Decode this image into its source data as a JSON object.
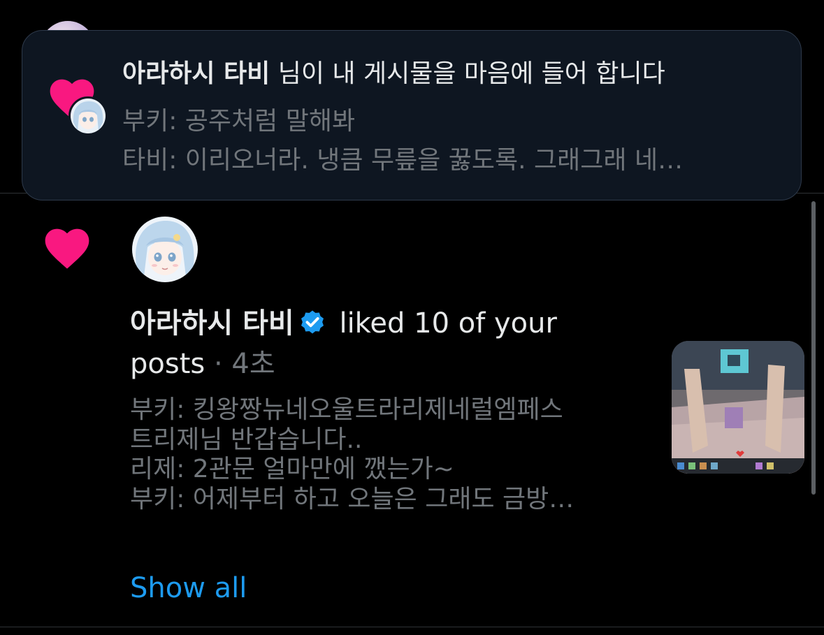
{
  "toast": {
    "username": "아라하시 타비",
    "action_text": " 님이 내 게시물을 마음에 들어 합니다",
    "preview_line1": "부키: 공주처럼 말해봐",
    "preview_line2": "타비: 이리오너라. 냉큼 무릎을 꿇도록. 그래그래 네…"
  },
  "notification": {
    "username": "아라하시 타비",
    "action_text": " liked 10 of your posts",
    "separator": " · ",
    "time": "4초",
    "quote_lines": [
      "부키: 킹왕짱뉴네오울트라리제네럴엠페스",
      "트리제님 반갑습니다..",
      "리제: 2관문 얼마만에 깼는가~",
      "부키: 어제부터 하고 오늘은 그래도 금방…"
    ],
    "show_all_label": "Show all"
  },
  "colors": {
    "heart": "#f91880",
    "link": "#1d9bf0",
    "muted": "#71767b",
    "verified": "#1d9bf0"
  },
  "icons": [
    "heart-icon",
    "verified-badge-icon"
  ]
}
